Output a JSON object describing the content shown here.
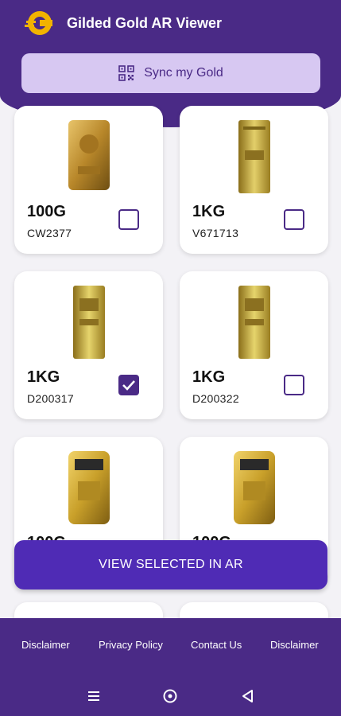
{
  "app": {
    "title": "Gilded Gold AR Viewer",
    "accent": "#4a2a86",
    "button_color": "#4f2bb5",
    "sync_color": "#d7c8f2"
  },
  "sync": {
    "label": "Sync my Gold",
    "icon": "qr-code-icon"
  },
  "cards": [
    {
      "weight": "100G",
      "serial": "CW2377",
      "checked": false
    },
    {
      "weight": "1KG",
      "serial": "V671713",
      "checked": false
    },
    {
      "weight": "1KG",
      "serial": "D200317",
      "checked": true
    },
    {
      "weight": "1KG",
      "serial": "D200322",
      "checked": false
    },
    {
      "weight": "100G",
      "serial": "",
      "checked": false
    },
    {
      "weight": "100G",
      "serial": "",
      "checked": false
    }
  ],
  "view_button": {
    "label": "VIEW SELECTED IN AR"
  },
  "footer": {
    "links": [
      "Disclaimer",
      "Privacy Policy",
      "Contact Us",
      "Disclaimer"
    ]
  },
  "navbar": {
    "icons": [
      "menu-icon",
      "home-circle-icon",
      "back-triangle-icon"
    ]
  }
}
